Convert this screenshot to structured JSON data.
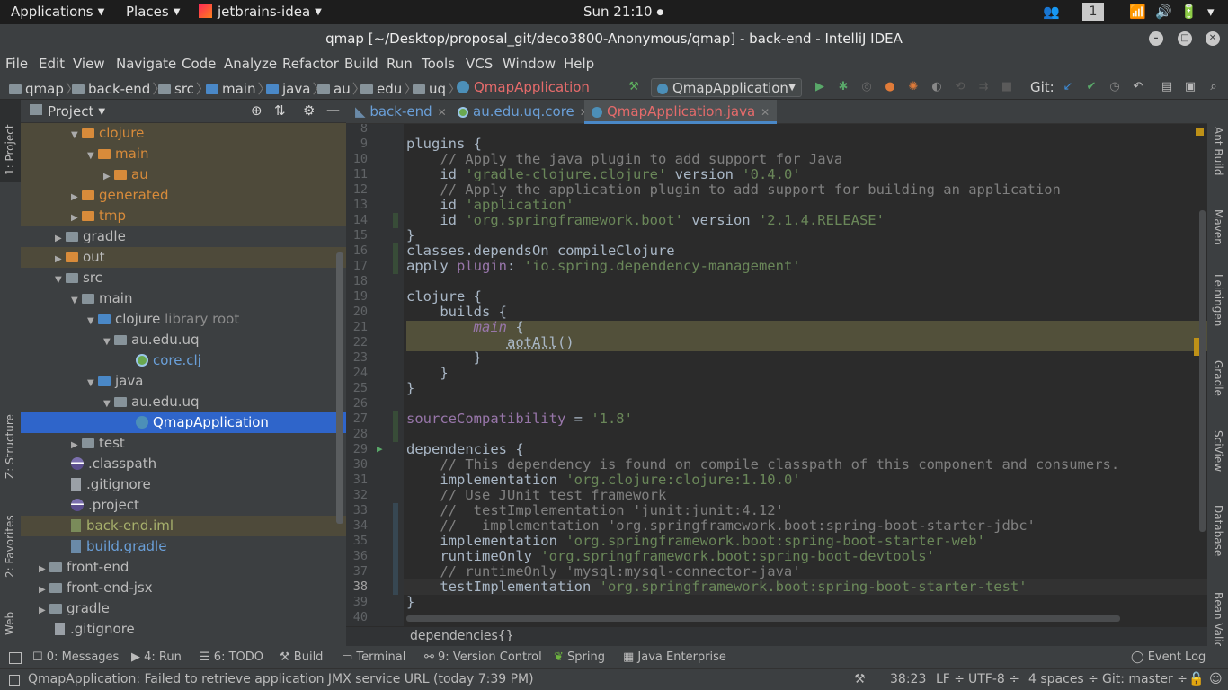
{
  "topbar": {
    "applications": "Applications",
    "places": "Places",
    "app": "jetbrains-idea",
    "clock": "Sun 21:10",
    "workspace": "1"
  },
  "window": {
    "title": "qmap [~/Desktop/proposal_git/deco3800-Anonymous/qmap] - back-end - IntelliJ IDEA"
  },
  "menu": [
    "File",
    "Edit",
    "View",
    "Navigate",
    "Code",
    "Analyze",
    "Refactor",
    "Build",
    "Run",
    "Tools",
    "VCS",
    "Window",
    "Help"
  ],
  "nav": {
    "crumbs": [
      "qmap",
      "back-end",
      "src",
      "main",
      "java",
      "au",
      "edu",
      "uq"
    ],
    "current": "QmapApplication",
    "run_config": "QmapApplication",
    "git_label": "Git:"
  },
  "left_stripe": {
    "project": "1: Project",
    "structure": "Z: Structure",
    "favorites": "2: Favorites",
    "web": "Web"
  },
  "right_stripe": {
    "ant": "Ant Build",
    "maven": "Maven",
    "leiningen": "Leiningen",
    "gradle": "Gradle",
    "sciview": "SciView",
    "database": "Database",
    "bean": "Bean Valid"
  },
  "project": {
    "header": "Project",
    "rows": [
      {
        "label": "clojure",
        "extra": ""
      },
      {
        "label": "main",
        "extra": ""
      },
      {
        "label": "au",
        "extra": ""
      },
      {
        "label": "generated",
        "extra": ""
      },
      {
        "label": "tmp",
        "extra": ""
      },
      {
        "label": "gradle",
        "extra": ""
      },
      {
        "label": "out",
        "extra": ""
      },
      {
        "label": "src",
        "extra": ""
      },
      {
        "label": "main",
        "extra": ""
      },
      {
        "label": "clojure",
        "extra": "library root"
      },
      {
        "label": "au.edu.uq",
        "extra": ""
      },
      {
        "label": "core.clj",
        "extra": ""
      },
      {
        "label": "java",
        "extra": ""
      },
      {
        "label": "au.edu.uq",
        "extra": ""
      },
      {
        "label": "QmapApplication",
        "extra": ""
      },
      {
        "label": "test",
        "extra": ""
      },
      {
        "label": ".classpath",
        "extra": ""
      },
      {
        "label": ".gitignore",
        "extra": ""
      },
      {
        "label": ".project",
        "extra": ""
      },
      {
        "label": "back-end.iml",
        "extra": ""
      },
      {
        "label": "build.gradle",
        "extra": ""
      },
      {
        "label": "front-end",
        "extra": ""
      },
      {
        "label": "front-end-jsx",
        "extra": ""
      },
      {
        "label": "gradle",
        "extra": ""
      },
      {
        "label": ".gitignore",
        "extra": ""
      }
    ]
  },
  "tabs": [
    {
      "label": "back-end"
    },
    {
      "label": "au.edu.uq.core"
    },
    {
      "label": "QmapApplication.java"
    }
  ],
  "code": {
    "line_numbers": [
      "8",
      "9",
      "10",
      "11",
      "12",
      "13",
      "14",
      "15",
      "16",
      "17",
      "18",
      "19",
      "20",
      "21",
      "22",
      "23",
      "24",
      "25",
      "26",
      "27",
      "28",
      "29",
      "30",
      "31",
      "32",
      "33",
      "34",
      "35",
      "36",
      "37",
      "38",
      "39",
      "40"
    ],
    "t": {
      "l9": "plugins {",
      "l10": "    // Apply the java plugin to add support for Java",
      "l11a": "    id ",
      "l11b": "'gradle-clojure.clojure'",
      "l11c": " version ",
      "l11d": "'0.4.0'",
      "l12": "    // Apply the application plugin to add support for building an application",
      "l13a": "    id ",
      "l13b": "'application'",
      "l14a": "    id ",
      "l14b": "'org.springframework.boot'",
      "l14c": " version ",
      "l14d": "'2.1.4.RELEASE'",
      "l15": "}",
      "l16": "classes.dependsOn compileClojure",
      "l17a": "apply ",
      "l17b": "plugin",
      "l17c": ": ",
      "l17d": "'io.spring.dependency-management'",
      "l19": "clojure {",
      "l20": "    builds {",
      "l21a": "        ",
      "l21b": "main",
      "l21c": " {",
      "l22a": "            ",
      "l22b": "aotAll",
      "l22c": "()",
      "l23": "        }",
      "l24": "    }",
      "l25": "}",
      "l27a": "sourceCompatibility",
      "l27b": " = ",
      "l27c": "'1.8'",
      "l29": "dependencies {",
      "l30": "    // This dependency is found on compile classpath of this component and consumers.",
      "l31a": "    implementation ",
      "l31b": "'org.clojure:clojure:1.10.0'",
      "l32": "    // Use JUnit test framework",
      "l33": "    //  testImplementation 'junit:junit:4.12'",
      "l34": "    //   implementation 'org.springframework.boot:spring-boot-starter-jdbc'",
      "l35a": "    implementation ",
      "l35b": "'org.springframework.boot:spring-boot-starter-web'",
      "l36a": "    runtimeOnly ",
      "l36b": "'org.springframework.boot:spring-boot-devtools'",
      "l37": "    // runtimeOnly 'mysql:mysql-connector-java'",
      "l38a": "    testImplementation ",
      "l38b": "'org.springframework.boot:spring-boot-starter-test'",
      "l39": "}"
    }
  },
  "editor_breadcrumb": "dependencies{}",
  "bottom_tabs": {
    "messages": "0: Messages",
    "run": "4: Run",
    "todo": "6: TODO",
    "build": "Build",
    "terminal": "Terminal",
    "vcs": "9: Version Control",
    "spring": "Spring",
    "javaee": "Java Enterprise",
    "eventlog": "Event Log"
  },
  "status": {
    "message": "QmapApplication: Failed to retrieve application JMX service URL (today 7:39 PM)",
    "position": "38:23",
    "line_sep": "LF ÷",
    "encoding": "UTF-8 ÷",
    "indent": "4 spaces ÷",
    "git": "Git: master ÷"
  }
}
